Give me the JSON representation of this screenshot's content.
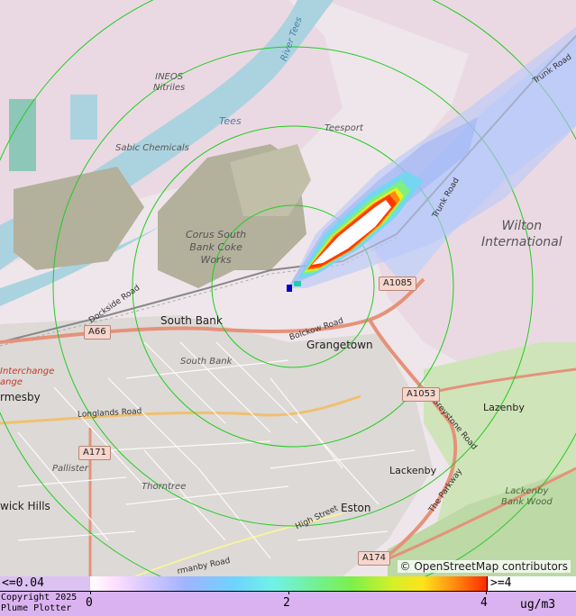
{
  "map": {
    "places": {
      "south_bank": "South Bank",
      "south_bank_small": "South Bank",
      "grangetown": "Grangetown",
      "eston": "Eston",
      "lackenby": "Lackenby",
      "lazenby": "Lazenby",
      "pallister": "Pallister",
      "thorntree": "Thorntree",
      "ormesby": "rmesby",
      "berwick_hills": "wick Hills",
      "wilton_international": "Wilton\nInternational",
      "lackenby_bank_wood": "Lackenby\nBank Wood"
    },
    "industrial": {
      "ineos": "INEOS\nNitriles",
      "sabic": "Sabic Chemicals",
      "teesport": "Teesport",
      "corus": "Corus South\nBank Coke\nWorks",
      "interchange": "Interchange\nange"
    },
    "water": {
      "tees": "Tees",
      "river_tees": "River Tees"
    },
    "roads": {
      "a66": "A66",
      "a171": "A171",
      "a1085": "A1085",
      "a1053": "A1053",
      "a174": "A174",
      "dockside": "Dockside Road",
      "bolckow": "Bolckow Road",
      "longlands": "Longlands Road",
      "greystone": "Greystone Road",
      "the_parkway": "The Parkway",
      "high_street": "High Street",
      "trunk_road": "Trunk Road",
      "normanby": "rmanby Road"
    },
    "attribution": "© OpenStreetMap contributors"
  },
  "legend": {
    "low_label": "<=0.04",
    "high_label": ">=4",
    "ticks": [
      "0",
      "2",
      "4"
    ],
    "unit": "ug/m3",
    "copyright_line1": "Copyright 2025",
    "copyright_line2": "Plume Plotter",
    "scale_min": 0,
    "scale_max": 4
  },
  "colors": {
    "ring": "#22cc22",
    "plume_core": "#ffffff",
    "plume_edge": "#ff3a00",
    "legend_bg": "#d9b2ef"
  }
}
